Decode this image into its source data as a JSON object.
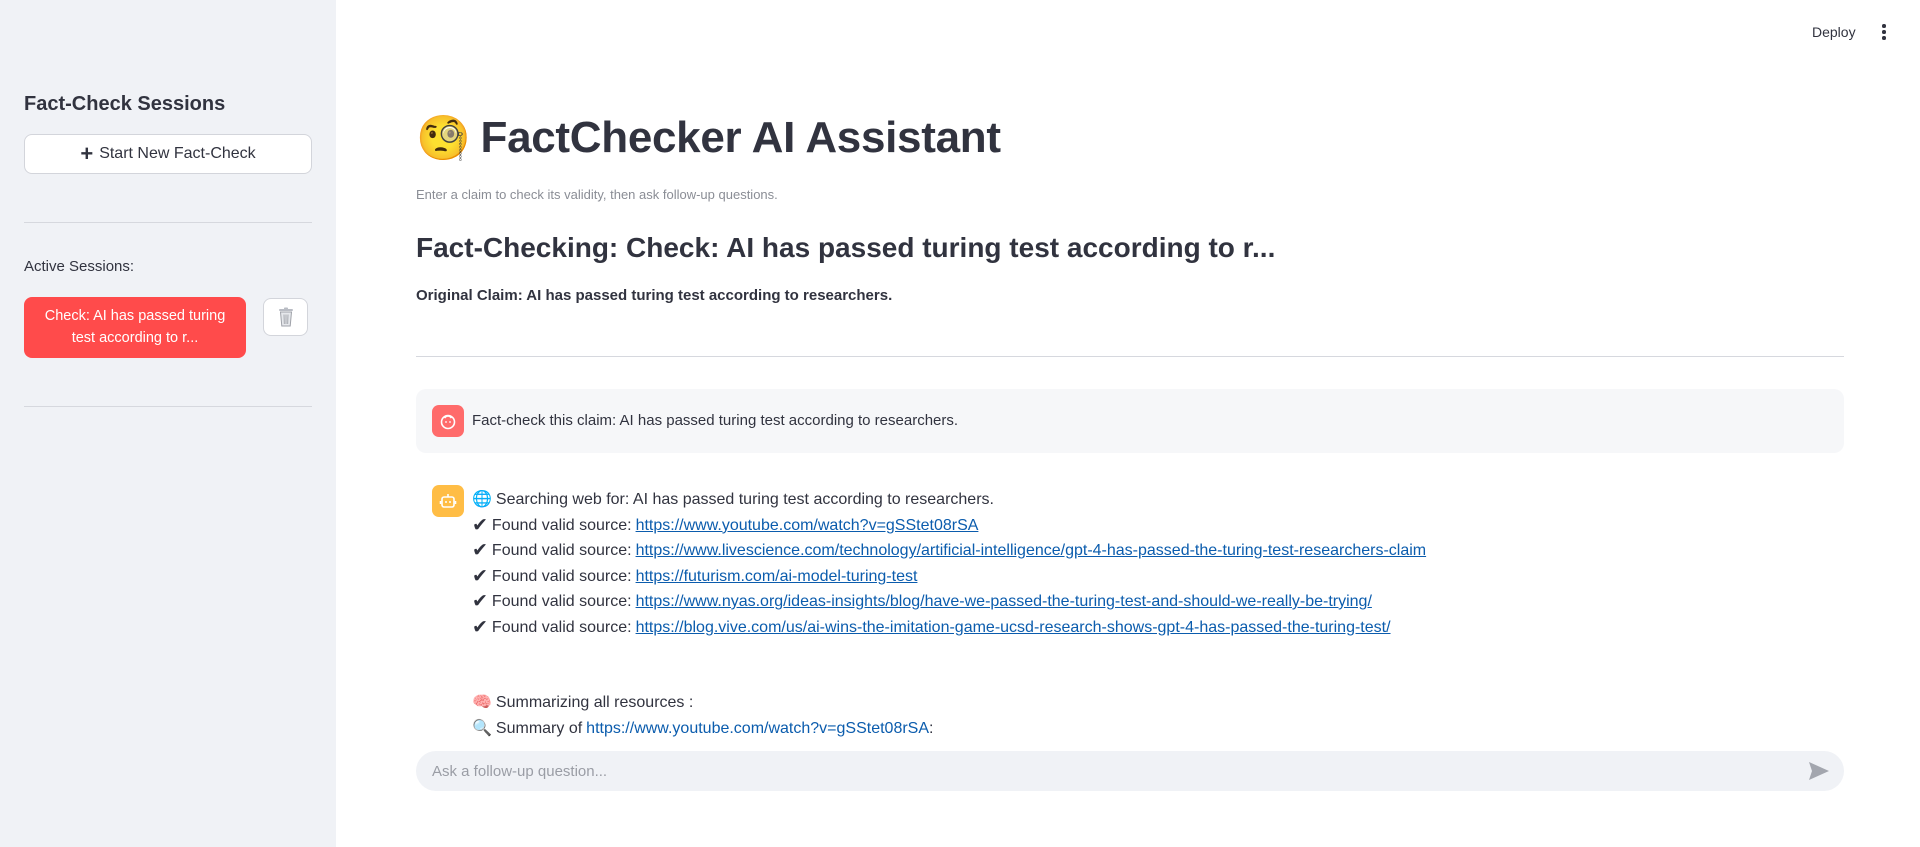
{
  "sidebar": {
    "title": "Fact-Check Sessions",
    "new_button": "Start New Fact-Check",
    "active_label": "Active Sessions:",
    "sessions": [
      {
        "label": "Check: AI has passed turing test according to r..."
      }
    ]
  },
  "header": {
    "deploy": "Deploy"
  },
  "main": {
    "title_emoji": "🧐",
    "title": "FactChecker AI Assistant",
    "subtitle": "Enter a claim to check its validity, then ask follow-up questions.",
    "heading": "Fact-Checking: Check: AI has passed turing test according to r...",
    "original_claim": "Original Claim: AI has passed turing test according to researchers.",
    "user_message": "Fact-check this claim: AI has passed turing test according to researchers.",
    "assistant": {
      "searching": "Searching web for: AI has passed turing test according to researchers.",
      "found_prefix": "Found valid source:",
      "sources": [
        "https://www.youtube.com/watch?v=gSStet08rSA",
        "https://www.livescience.com/technology/artificial-intelligence/gpt-4-has-passed-the-turing-test-researchers-claim",
        "https://futurism.com/ai-model-turing-test",
        "https://www.nyas.org/ideas-insights/blog/have-we-passed-the-turing-test-and-should-we-really-be-trying/",
        "https://blog.vive.com/us/ai-wins-the-imitation-game-ucsd-research-shows-gpt-4-has-passed-the-turing-test/"
      ],
      "summarizing": "Summarizing all resources :",
      "summary_prefix": "Summary of",
      "summary_link": "https://www.youtube.com/watch?v=gSStet08rSA",
      "summary_suffix": ":"
    },
    "chat_placeholder": "Ask a follow-up question..."
  }
}
